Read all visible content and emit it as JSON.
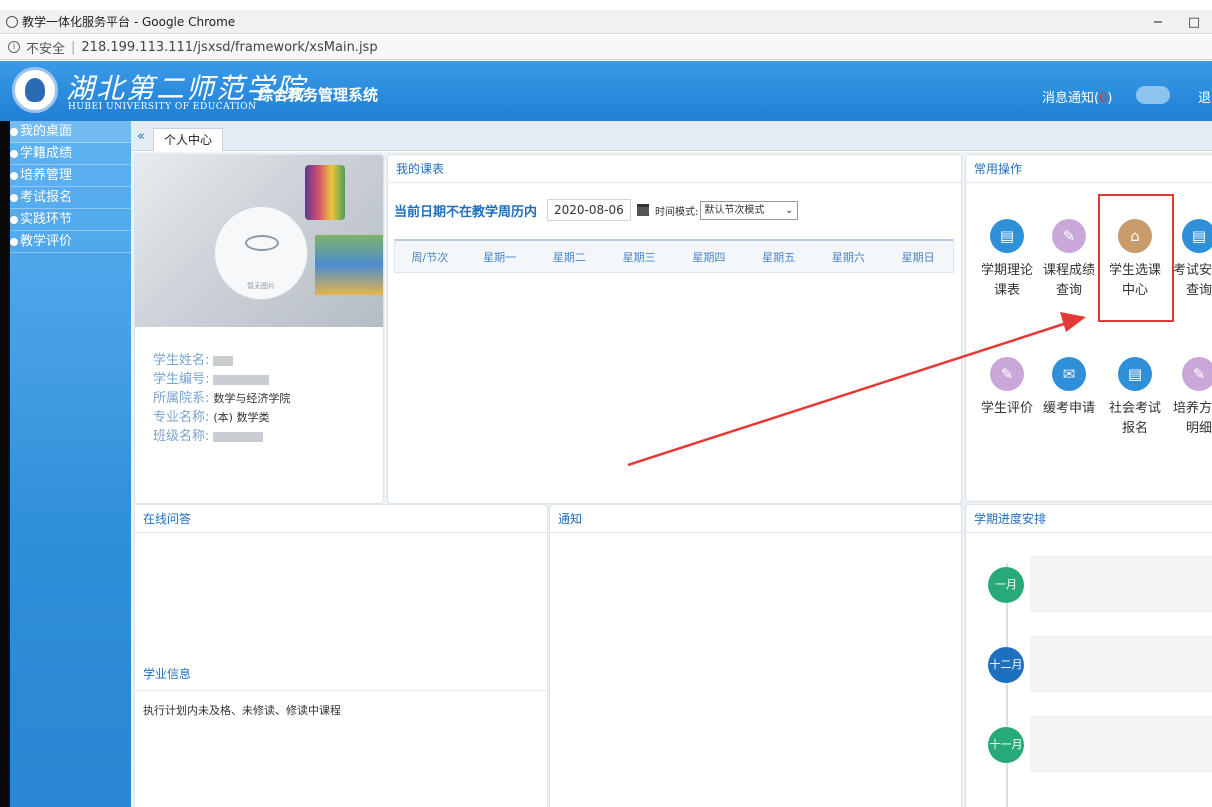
{
  "browser": {
    "window_title": "教学一体化服务平台 - Google Chrome",
    "controls": {
      "minimize": "−",
      "maximize": "□"
    },
    "security_label": "不安全",
    "url": "218.199.113.111/jsxsd/framework/xsMain.jsp"
  },
  "header": {
    "university_cn": "湖北第二师范学院",
    "university_en": "HUBEI UNIVERSITY OF EDUCATION",
    "system_name": "综合教务管理系统",
    "message_label": "消息通知(",
    "message_count": "0",
    "message_suffix": ")",
    "logout": "退"
  },
  "sidebar": {
    "items": [
      {
        "label": "我的桌面"
      },
      {
        "label": "学籍成绩"
      },
      {
        "label": "培养管理"
      },
      {
        "label": "考试报名"
      },
      {
        "label": "实践环节"
      },
      {
        "label": "教学评价"
      }
    ]
  },
  "tabs": {
    "collapse": "«",
    "active": "个人中心"
  },
  "profile": {
    "avatar_caption": "暂无图片",
    "rows": [
      {
        "label": "学生姓名:",
        "value": ""
      },
      {
        "label": "学生编号:",
        "value": ""
      },
      {
        "label": "所属院系:",
        "value": "数学与经济学院"
      },
      {
        "label": "专业名称:",
        "value": "(本) 数学类"
      },
      {
        "label": "班级名称:",
        "value": ""
      }
    ]
  },
  "schedule": {
    "title": "我的课表",
    "warning": "当前日期不在教学周历内",
    "date": "2020-08-06",
    "mode_label": "时间模式:",
    "mode_value": "默认节次模式",
    "columns": [
      "周/节次",
      "星期一",
      "星期二",
      "星期三",
      "星期四",
      "星期五",
      "星期六",
      "星期日"
    ]
  },
  "ops": {
    "title": "常用操作",
    "items": [
      {
        "line1": "学期理论",
        "line2": "课表",
        "icon": "document-icon"
      },
      {
        "line1": "课程成绩",
        "line2": "查询",
        "icon": "pen-icon"
      },
      {
        "line1": "学生选课",
        "line2": "中心",
        "icon": "bank-icon"
      },
      {
        "line1": "考试安排",
        "line2": "查询",
        "icon": "document-icon"
      },
      {
        "line1": "学生评价",
        "line2": "",
        "icon": "pen-icon"
      },
      {
        "line1": "缓考申请",
        "line2": "",
        "icon": "mail-icon"
      },
      {
        "line1": "社会考试",
        "line2": "报名",
        "icon": "document-icon"
      },
      {
        "line1": "培养方案",
        "line2": "明细",
        "icon": "pen-icon"
      }
    ]
  },
  "qa": {
    "title": "在线问答",
    "study_title": "学业信息",
    "study_text": "执行计划内未及格、未修读、修读中课程"
  },
  "notice": {
    "title": "通知"
  },
  "progress": {
    "title": "学期进度安排",
    "months": [
      "一月",
      "十二月",
      "十一月"
    ]
  },
  "colors": {
    "accent": "#2f8fd9",
    "highlight": "#e53935",
    "sidebar": "#3b9ae8"
  }
}
